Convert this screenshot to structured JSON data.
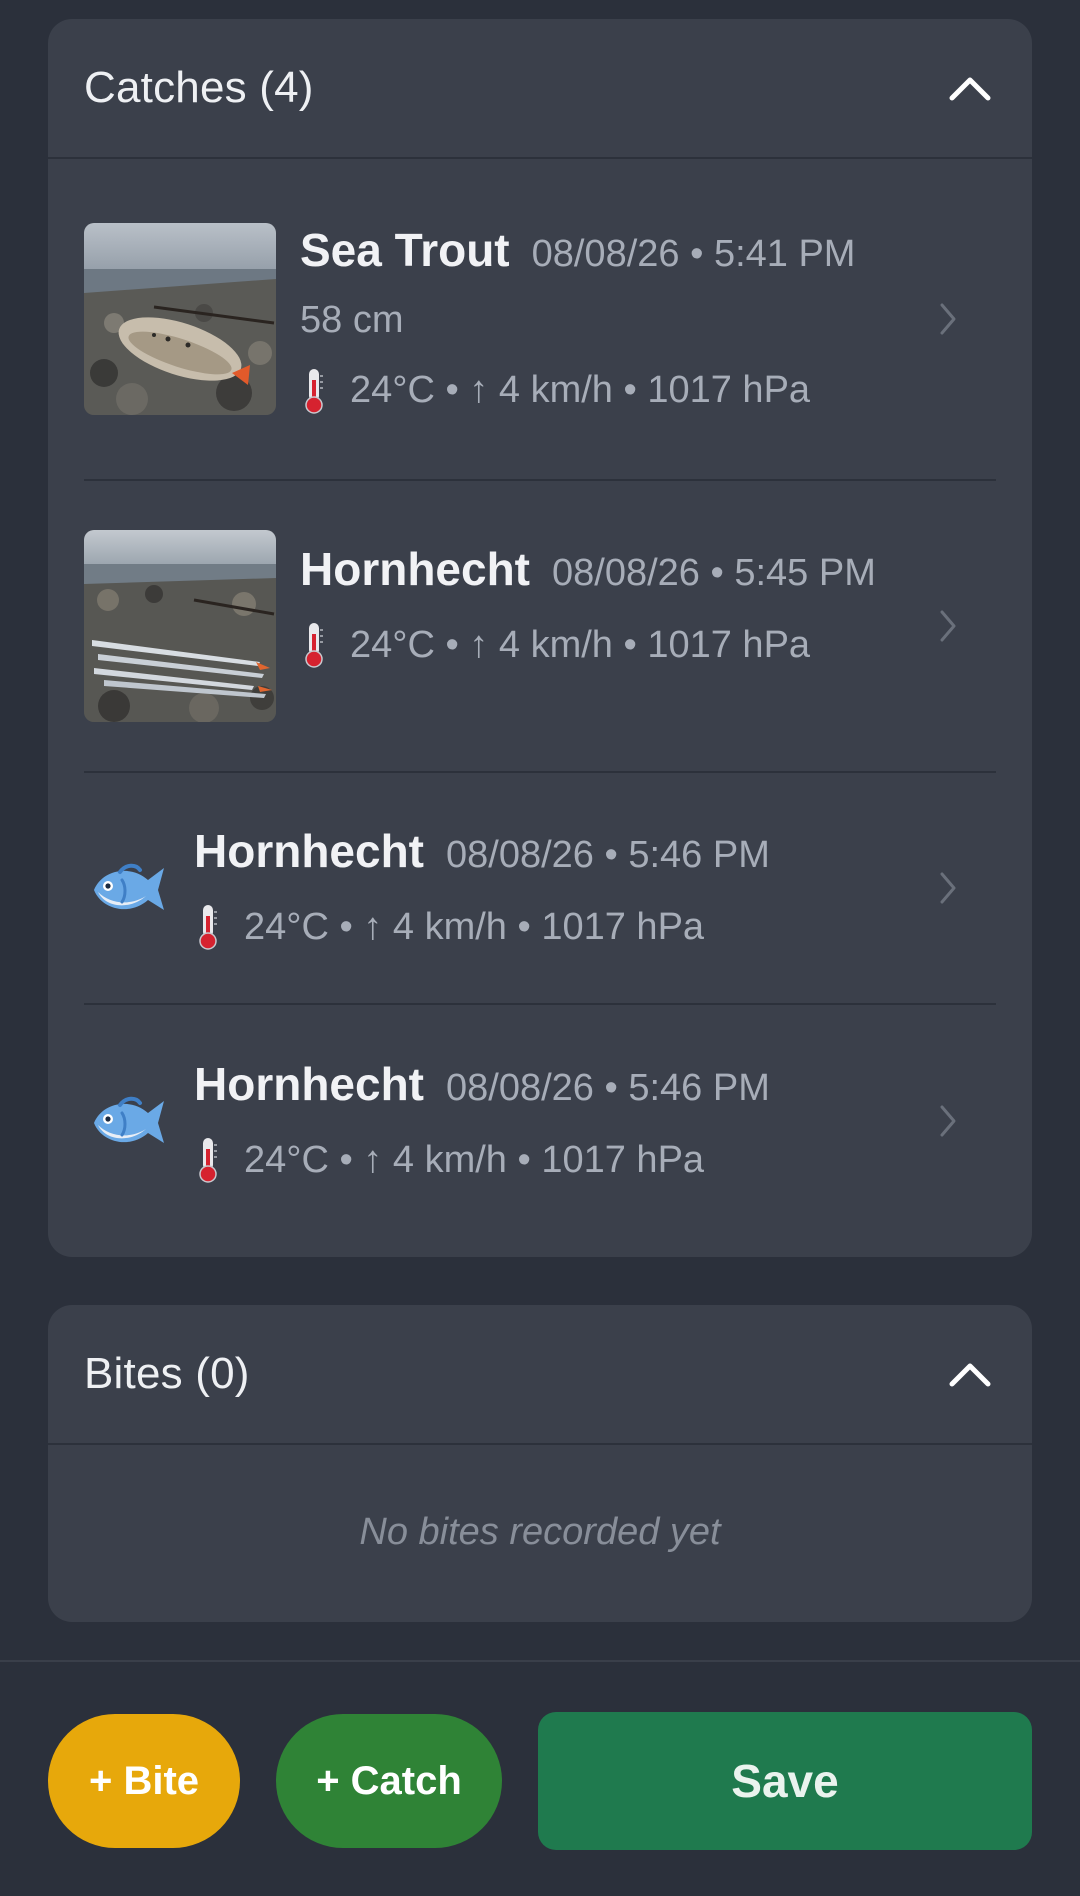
{
  "catches": {
    "title": "Catches (4)",
    "items": [
      {
        "species": "Sea Trout",
        "datetime": "08/08/26 • 5:41 PM",
        "size": "58 cm",
        "weather": "24°C • ↑ 4 km/h • 1017 hPa",
        "media": "photo"
      },
      {
        "species": "Hornhecht",
        "datetime": "08/08/26 • 5:45 PM",
        "weather": "24°C • ↑ 4 km/h • 1017 hPa",
        "media": "photo"
      },
      {
        "species": "Hornhecht",
        "datetime": "08/08/26 • 5:46 PM",
        "weather": "24°C • ↑ 4 km/h • 1017 hPa",
        "media": "fish-icon"
      },
      {
        "species": "Hornhecht",
        "datetime": "08/08/26 • 5:46 PM",
        "weather": "24°C • ↑ 4 km/h • 1017 hPa",
        "media": "fish-icon"
      }
    ]
  },
  "bites": {
    "title": "Bites (0)",
    "empty_text": "No bites recorded yet"
  },
  "actions": {
    "bite_label": "+ Bite",
    "catch_label": "+ Catch",
    "save_label": "Save"
  },
  "colors": {
    "background": "#2b303b",
    "card": "#3b404b",
    "bite_button": "#e7a80b",
    "catch_button": "#2f8336",
    "save_button": "#1f7a4e"
  }
}
